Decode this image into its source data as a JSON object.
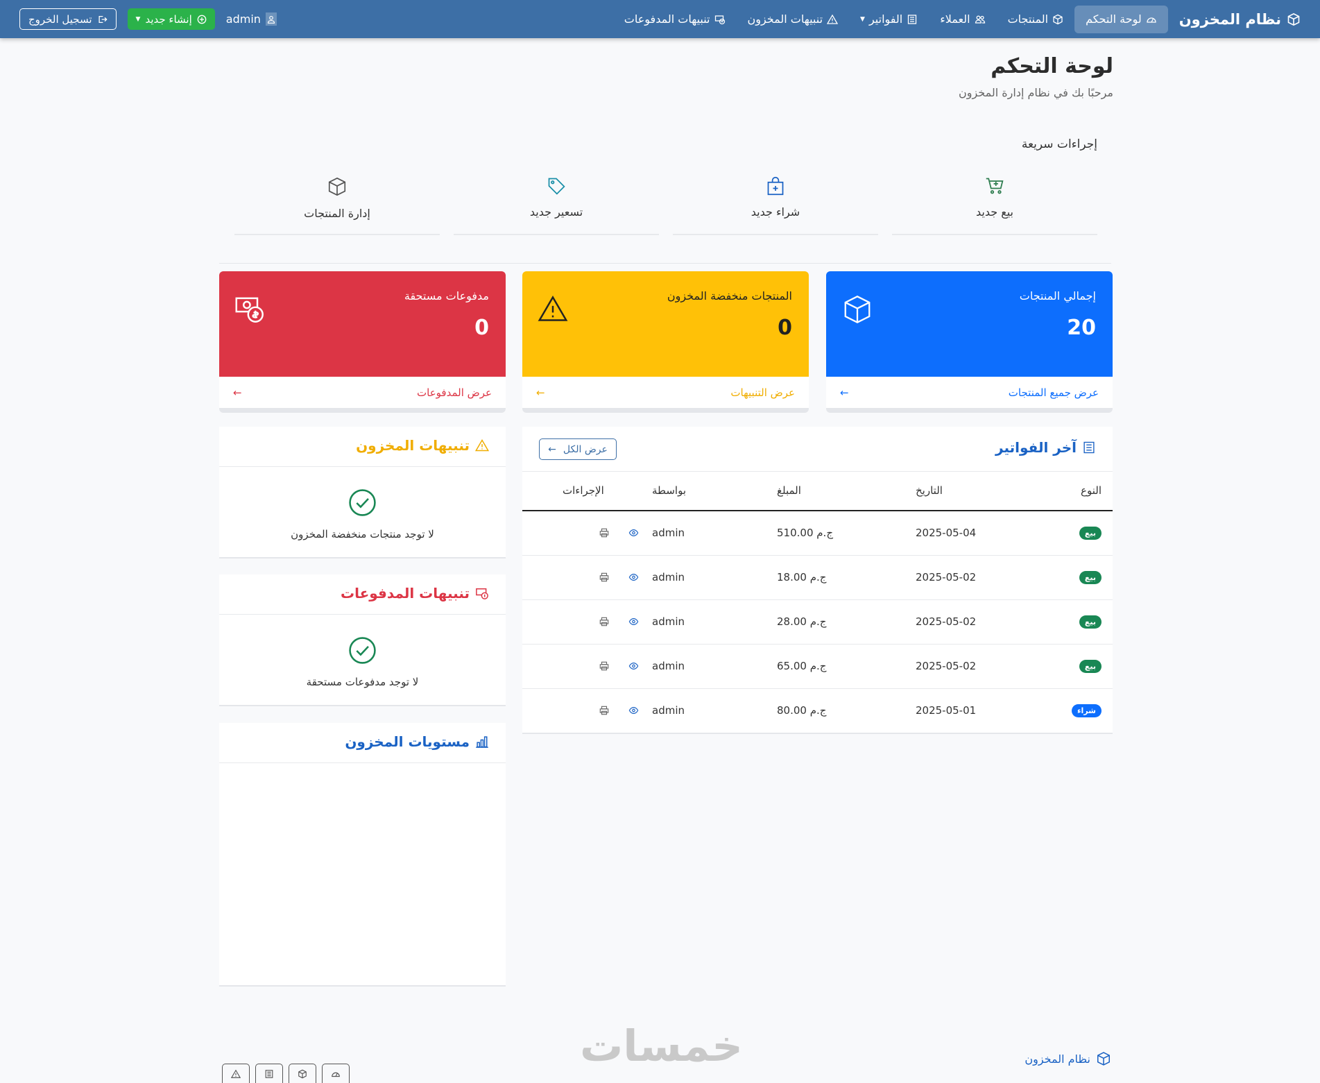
{
  "nav": {
    "brand": "نظام المخزون",
    "items": [
      {
        "label": "لوحة التحكم",
        "icon": "speedometer-icon"
      },
      {
        "label": "المنتجات",
        "icon": "box-icon"
      },
      {
        "label": "العملاء",
        "icon": "people-icon"
      },
      {
        "label": "الفواتير",
        "icon": "receipt-icon"
      },
      {
        "label": "تنبيهات المخزون",
        "icon": "warning-icon"
      },
      {
        "label": "تنبيهات المدفوعات",
        "icon": "cash-icon"
      }
    ],
    "user": "admin",
    "create_label": "إنشاء جديد",
    "logout_label": "تسجيل الخروج"
  },
  "page": {
    "title": "لوحة التحكم",
    "subtitle": "مرحبًا بك في نظام إدارة المخزون"
  },
  "quick_actions": {
    "title": "إجراءات سريعة",
    "items": [
      {
        "label": "بيع جديد",
        "icon": "cart-plus-icon",
        "color": "#2e7d4f"
      },
      {
        "label": "شراء جديد",
        "icon": "bag-plus-icon",
        "color": "#1a62c4"
      },
      {
        "label": "تسعير جديد",
        "icon": "tag-icon",
        "color": "#1a8fa8"
      },
      {
        "label": "إدارة المنتجات",
        "icon": "box-icon",
        "color": "#555555"
      }
    ]
  },
  "stats": [
    {
      "label": "إجمالي المنتجات",
      "value": "20",
      "link": "عرض جميع المنتجات",
      "color": "#0d6efd",
      "link_color": "#0d6efd"
    },
    {
      "label": "المنتجات منخفضة المخزون",
      "value": "0",
      "link": "عرض التنبيهات",
      "color": "#ffc107",
      "link_color": "#f0ad00"
    },
    {
      "label": "مدفوعات مستحقة",
      "value": "0",
      "link": "عرض المدفوعات",
      "color": "#dc3545",
      "link_color": "#dc3545"
    }
  ],
  "invoices": {
    "title": "آخر الفواتير",
    "view_all": "عرض الكل",
    "columns": [
      "النوع",
      "التاريخ",
      "المبلغ",
      "بواسطة",
      "الإجراءات"
    ],
    "rows": [
      {
        "type": "بيع",
        "date": "2025-05-04",
        "amount": "510.00 ج.م",
        "by": "admin"
      },
      {
        "type": "بيع",
        "date": "2025-05-02",
        "amount": "18.00 ج.م",
        "by": "admin"
      },
      {
        "type": "بيع",
        "date": "2025-05-02",
        "amount": "28.00 ج.م",
        "by": "admin"
      },
      {
        "type": "بيع",
        "date": "2025-05-02",
        "amount": "65.00 ج.م",
        "by": "admin"
      },
      {
        "type": "شراء",
        "date": "2025-05-01",
        "amount": "80.00 ج.م",
        "by": "admin"
      }
    ]
  },
  "stock_alerts": {
    "title": "تنبيهات المخزون",
    "empty": "لا توجد منتجات منخفضة المخزون",
    "color": "#f0ad00"
  },
  "payment_alerts": {
    "title": "تنبيهات المدفوعات",
    "empty": "لا توجد مدفوعات مستحقة",
    "color": "#dc3545"
  },
  "stock_levels": {
    "title": "مستويات المخزون",
    "color": "#0d6efd"
  },
  "footer": {
    "brand": "نظام المخزون",
    "watermark": "خمسات"
  }
}
